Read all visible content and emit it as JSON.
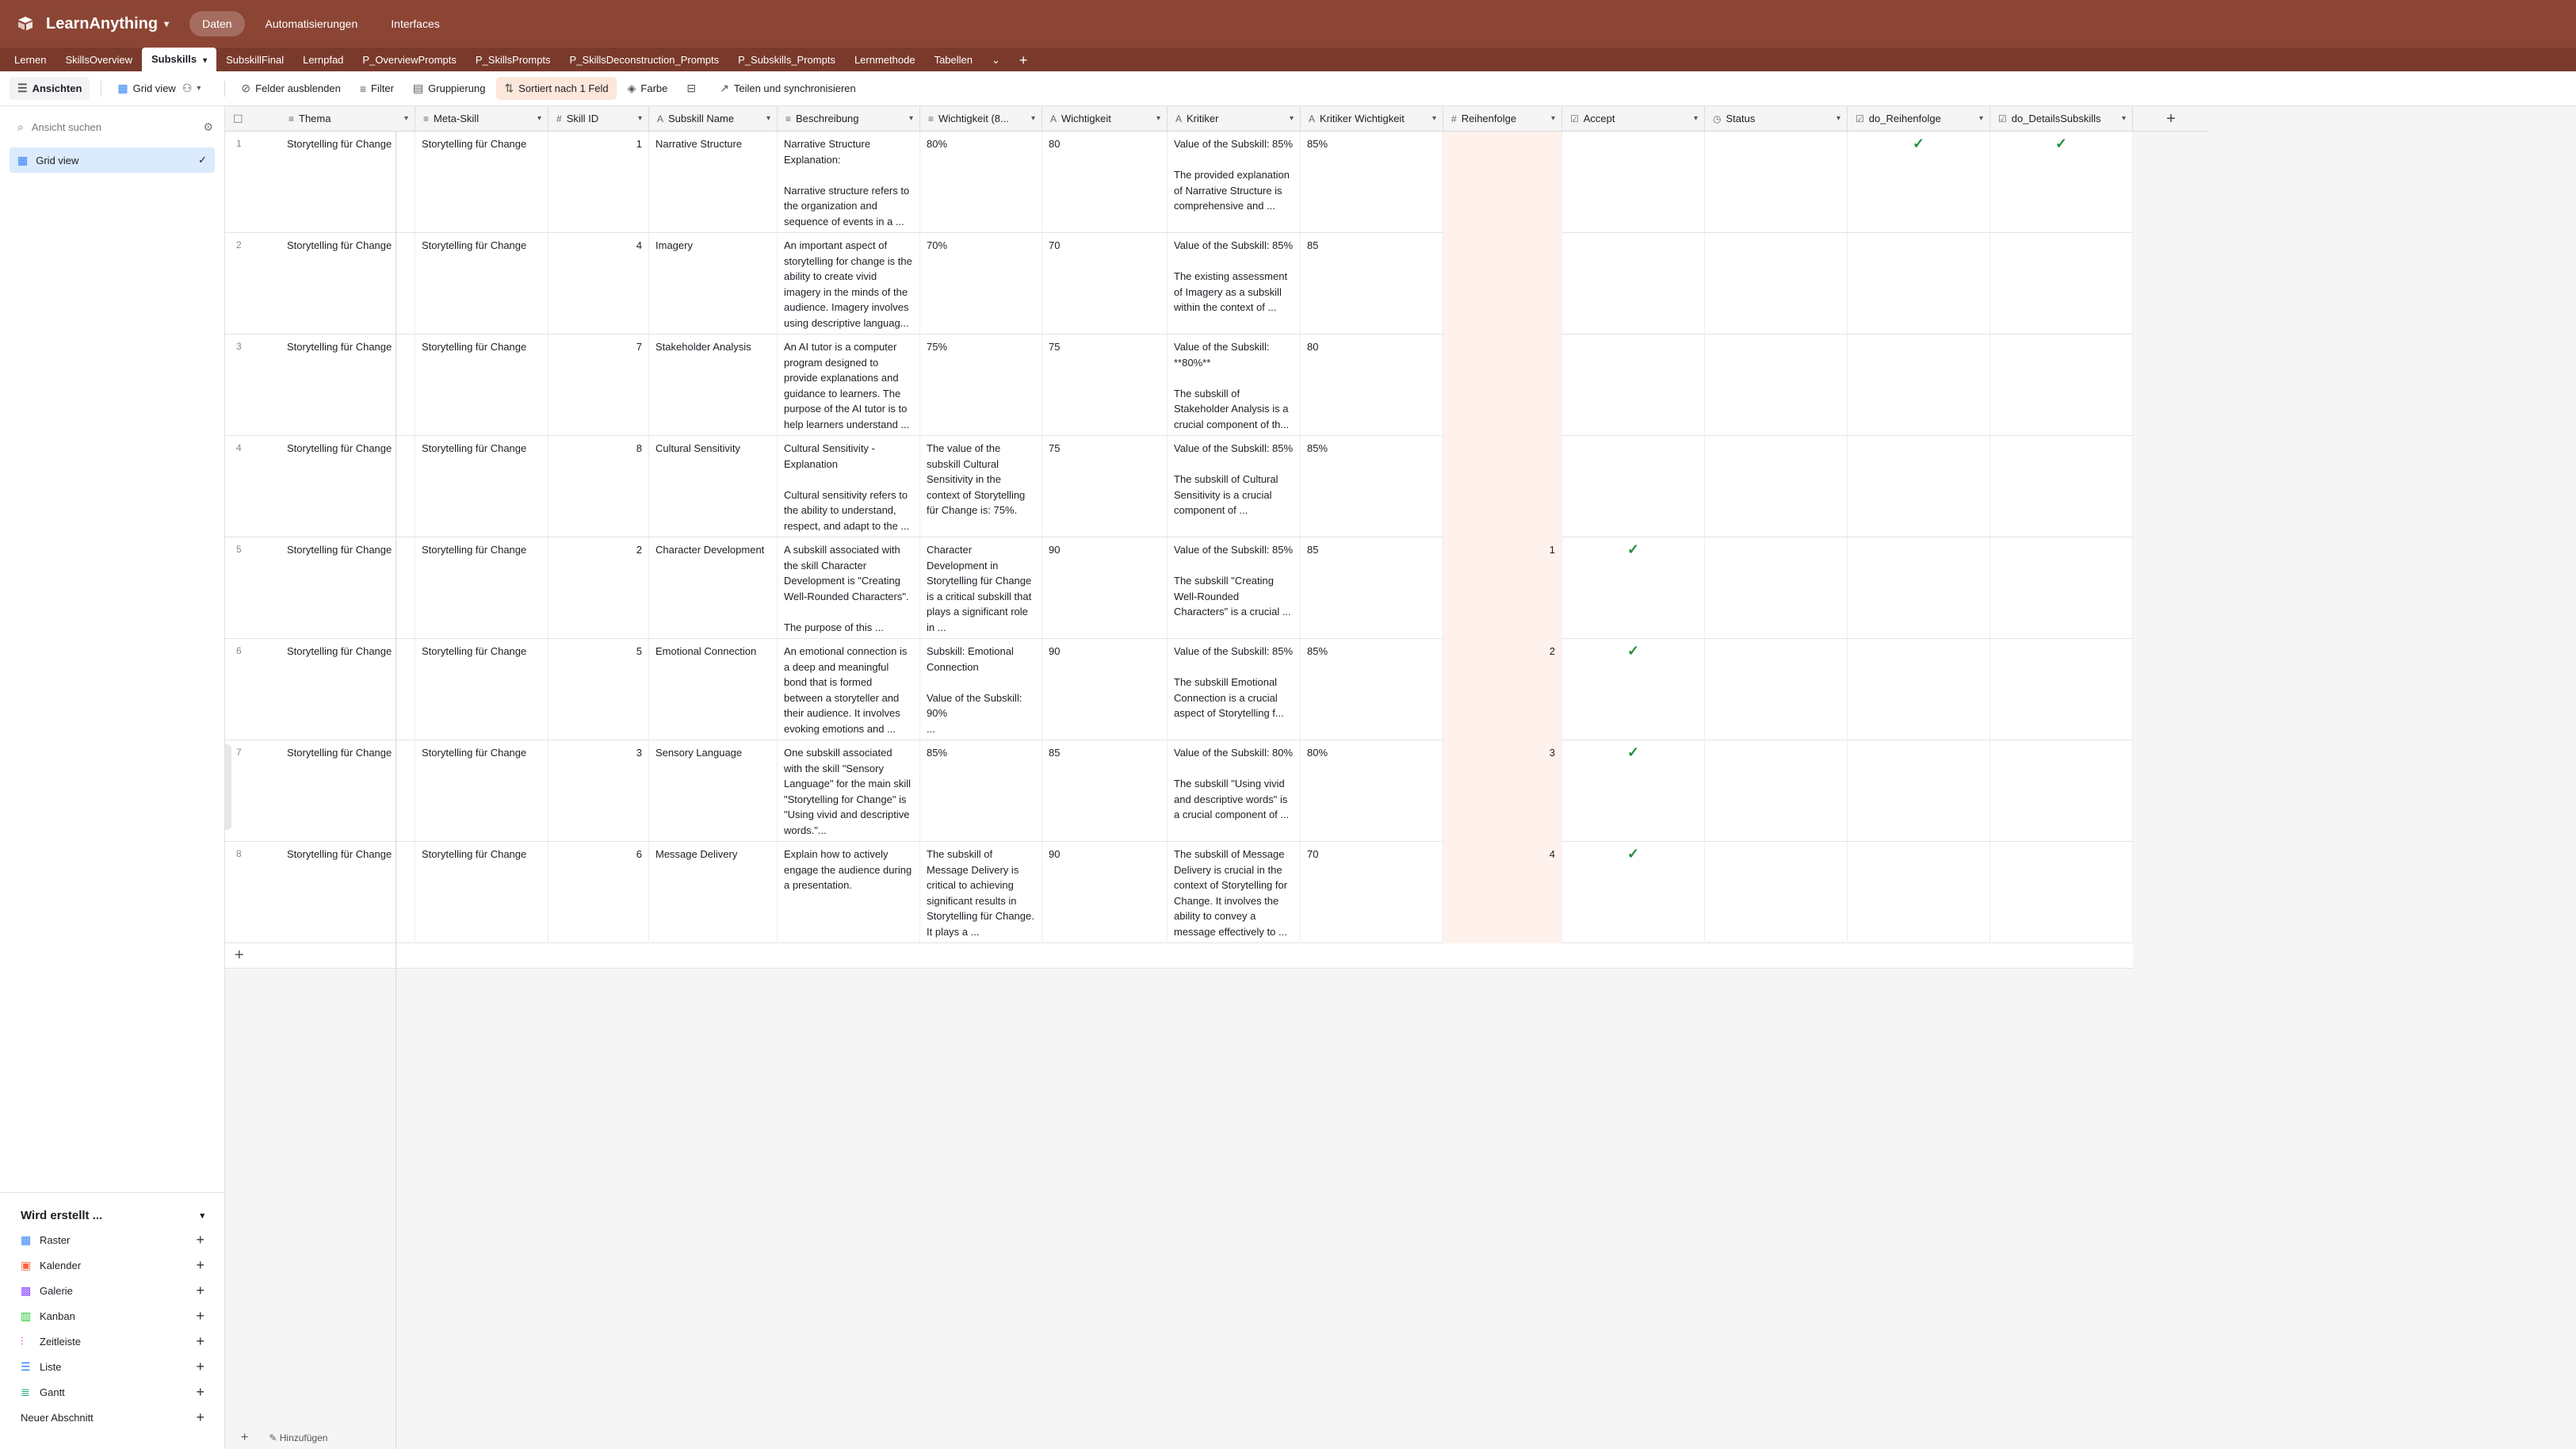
{
  "app": {
    "base_name": "LearnAnything",
    "nav": [
      "Daten",
      "Automatisierungen",
      "Interfaces"
    ],
    "active_nav": "Daten"
  },
  "tables": [
    "Lernen",
    "SkillsOverview",
    "Subskills",
    "SubskillFinal",
    "Lernpfad",
    "P_OverviewPrompts",
    "P_SkillsPrompts",
    "P_SkillsDeconstruction_Prompts",
    "P_Subskills_Prompts",
    "Lernmethode",
    "Tabellen"
  ],
  "active_table": "Subskills",
  "toolbar": {
    "views": "Ansichten",
    "view_name": "Grid view",
    "hide_fields": "Felder ausblenden",
    "filter": "Filter",
    "group": "Gruppierung",
    "sort": "Sortiert nach 1 Feld",
    "color": "Farbe",
    "share": "Teilen und synchronisieren"
  },
  "sidebar": {
    "search_placeholder": "Ansicht suchen",
    "views": [
      {
        "label": "Grid view",
        "active": true
      }
    ],
    "create_header": "Wird erstellt ...",
    "create_items": [
      {
        "label": "Raster",
        "icon": "grid-icon",
        "color": "#2d7ff9"
      },
      {
        "label": "Kalender",
        "icon": "calendar-icon",
        "color": "#f7653b"
      },
      {
        "label": "Galerie",
        "icon": "gallery-icon",
        "color": "#8b46ff"
      },
      {
        "label": "Kanban",
        "icon": "kanban-icon",
        "color": "#20c933"
      },
      {
        "label": "Zeitleiste",
        "icon": "timeline-icon",
        "color": "#ff08c2"
      },
      {
        "label": "Liste",
        "icon": "list-icon",
        "color": "#2d7ff9"
      },
      {
        "label": "Gantt",
        "icon": "gantt-icon",
        "color": "#11a87e"
      }
    ],
    "new_section": "Neuer Abschnitt"
  },
  "columns": [
    "Thema",
    "Meta-Skill",
    "Skill ID",
    "Subskill Name",
    "Beschreibung",
    "Wichtigkeit (8...",
    "Wichtigkeit",
    "Kritiker",
    "Kritiker Wichtigkeit",
    "Reihenfolge",
    "Accept",
    "Status",
    "do_Reihenfolge",
    "do_DetailsSubskills"
  ],
  "rows": [
    {
      "n": "1",
      "thema": "Storytelling für Change",
      "meta": "Storytelling für Change",
      "skill_id": "1",
      "name": "Narrative Structure",
      "beschreibung": "Narrative Structure Explanation:\n\nNarrative structure refers to the organization and sequence of events in a ...",
      "wicht8": "80%",
      "wicht": "80",
      "kritiker": "Value of the Subskill: 85%\n\nThe provided explanation of Narrative Structure is comprehensive and ...",
      "kw": "85%",
      "reihenfolge": "",
      "accept": false,
      "status": "",
      "do_r": true,
      "do_d": true
    },
    {
      "n": "2",
      "thema": "Storytelling für Change",
      "meta": "Storytelling für Change",
      "skill_id": "4",
      "name": "Imagery",
      "beschreibung": "An important aspect of storytelling for change is the ability to create vivid imagery in the minds of the audience. Imagery involves using descriptive languag...",
      "wicht8": "70%",
      "wicht": "70",
      "kritiker": "Value of the Subskill: 85%\n\nThe existing assessment of Imagery as a subskill within the context of ...",
      "kw": "85",
      "reihenfolge": "",
      "accept": false,
      "status": "",
      "do_r": false,
      "do_d": false
    },
    {
      "n": "3",
      "thema": "Storytelling für Change",
      "meta": "Storytelling für Change",
      "skill_id": "7",
      "name": "Stakeholder Analysis",
      "beschreibung": "An AI tutor is a computer program designed to provide explanations and guidance to learners. The purpose of the AI tutor is to help learners understand ...",
      "wicht8": "75%",
      "wicht": "75",
      "kritiker": "Value of the Subskill: **80%**\n\nThe subskill of Stakeholder Analysis is a crucial component of th...",
      "kw": "80",
      "reihenfolge": "",
      "accept": false,
      "status": "",
      "do_r": false,
      "do_d": false
    },
    {
      "n": "4",
      "thema": "Storytelling für Change",
      "meta": "Storytelling für Change",
      "skill_id": "8",
      "name": "Cultural Sensitivity",
      "beschreibung": "Cultural Sensitivity - Explanation\n\nCultural sensitivity refers to the ability to understand, respect, and adapt to the ...",
      "wicht8": "The value of the subskill Cultural Sensitivity in the context of Storytelling für Change is: 75%.",
      "wicht": "75",
      "kritiker": "Value of the Subskill: 85%\n\nThe subskill of Cultural Sensitivity is a crucial component of ...",
      "kw": "85%",
      "reihenfolge": "",
      "accept": false,
      "status": "",
      "do_r": false,
      "do_d": false
    },
    {
      "n": "5",
      "thema": "Storytelling für Change",
      "meta": "Storytelling für Change",
      "skill_id": "2",
      "name": "Character Development",
      "beschreibung": "A subskill associated with the skill Character Development is \"Creating Well-Rounded Characters\".\n\nThe purpose of this ...",
      "wicht8": "Character Development in Storytelling für Change is a critical subskill that plays a significant role in ...",
      "wicht": "90",
      "kritiker": "Value of the Subskill: 85%\n\nThe subskill \"Creating Well-Rounded Characters\" is a crucial ...",
      "kw": "85",
      "reihenfolge": "1",
      "accept": true,
      "status": "",
      "do_r": false,
      "do_d": false
    },
    {
      "n": "6",
      "thema": "Storytelling für Change",
      "meta": "Storytelling für Change",
      "skill_id": "5",
      "name": "Emotional Connection",
      "beschreibung": "An emotional connection is a deep and meaningful bond that is formed between a storyteller and their audience. It involves evoking emotions and ...",
      "wicht8": "Subskill: Emotional Connection\n\nValue of the Subskill: 90%\n...",
      "wicht": "90",
      "kritiker": "Value of the Subskill: 85%\n\nThe subskill Emotional Connection is a crucial aspect of Storytelling f...",
      "kw": "85%",
      "reihenfolge": "2",
      "accept": true,
      "status": "",
      "do_r": false,
      "do_d": false
    },
    {
      "n": "7",
      "thema": "Storytelling für Change",
      "meta": "Storytelling für Change",
      "skill_id": "3",
      "name": "Sensory Language",
      "beschreibung": "One subskill associated with the skill \"Sensory Language\" for the main skill \"Storytelling for Change\" is \"Using vivid and descriptive words.\"...",
      "wicht8": "85%",
      "wicht": "85",
      "kritiker": "Value of the Subskill: 80%\n\nThe subskill \"Using vivid and descriptive words\" is a crucial component of ...",
      "kw": "80%",
      "reihenfolge": "3",
      "accept": true,
      "status": "",
      "do_r": false,
      "do_d": false
    },
    {
      "n": "8",
      "thema": "Storytelling für Change",
      "meta": "Storytelling für Change",
      "skill_id": "6",
      "name": "Message Delivery",
      "beschreibung": "Explain how to actively engage the audience during a presentation.",
      "wicht8": "The subskill of Message Delivery is critical to achieving significant results in Storytelling für Change. It plays a ...",
      "wicht": "90",
      "kritiker": "The subskill of Message Delivery is crucial in the context of Storytelling for Change. It involves the ability to convey a message effectively to ...",
      "kw": "70",
      "reihenfolge": "4",
      "accept": true,
      "status": "",
      "do_r": false,
      "do_d": false
    }
  ],
  "footer": {
    "add_label": "Hinzufügen"
  },
  "colors": {
    "header": "#8c4534",
    "tabbar": "#7a3a2b",
    "accent": "#2d7ff9",
    "check": "#1e8e3e",
    "sort_highlight": "#fff2ed"
  }
}
